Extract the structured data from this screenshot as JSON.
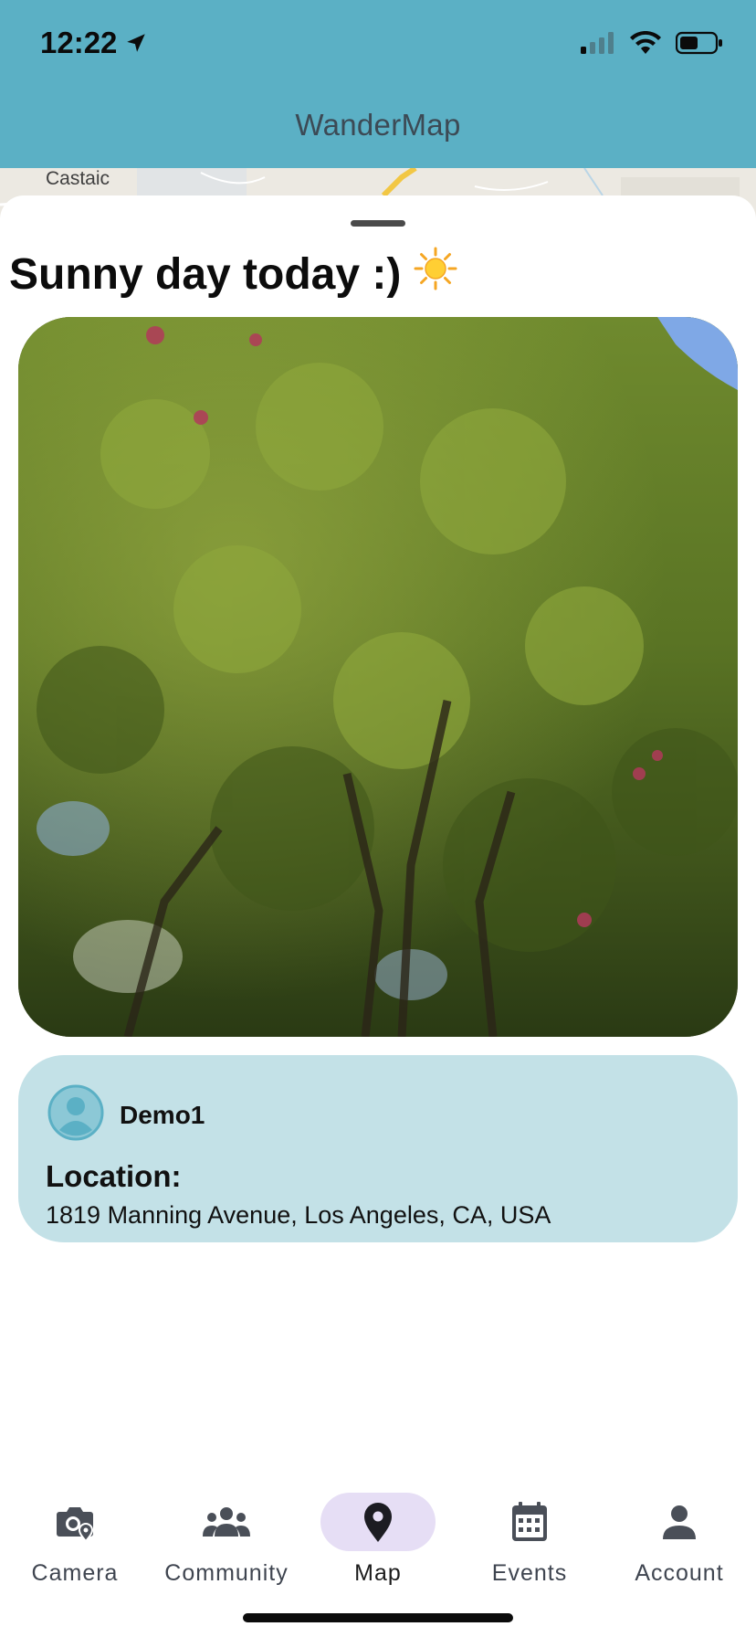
{
  "status": {
    "time": "12:22"
  },
  "app": {
    "title": "WanderMap"
  },
  "map": {
    "label": "Castaic"
  },
  "post": {
    "title": "Sunny day today :)",
    "emoji": "☀️",
    "user": "Demo1",
    "location_label": "Location:",
    "location_value": "1819 Manning Avenue, Los Angeles, CA, USA"
  },
  "tabs": [
    {
      "label": "Camera",
      "icon": "camera-location-icon"
    },
    {
      "label": "Community",
      "icon": "community-icon"
    },
    {
      "label": "Map",
      "icon": "map-pin-icon",
      "active": true
    },
    {
      "label": "Events",
      "icon": "calendar-icon"
    },
    {
      "label": "Account",
      "icon": "person-icon"
    }
  ],
  "colors": {
    "header": "#5bb0c5",
    "card": "#c3e1e7",
    "active_tab": "#e6def5"
  }
}
